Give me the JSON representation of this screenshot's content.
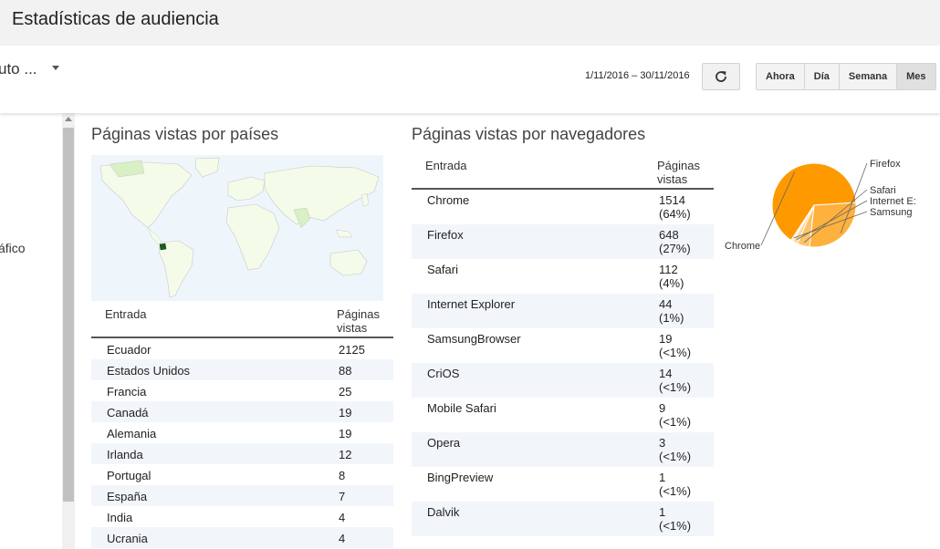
{
  "header": {
    "title": "Estadísticas de audiencia"
  },
  "toolbar": {
    "dropdown_text": "uto ...",
    "date_range": "1/11/2016 – 30/11/2016",
    "refresh_icon": "refresh-icon",
    "periods": [
      {
        "label": "Ahora",
        "active": false
      },
      {
        "label": "Día",
        "active": false
      },
      {
        "label": "Semana",
        "active": false
      },
      {
        "label": "Mes",
        "active": true
      }
    ]
  },
  "sidebar": {
    "label": "áfico"
  },
  "countries": {
    "title": "Páginas vistas por países",
    "columns": [
      "Entrada",
      "Páginas vistas"
    ],
    "rows": [
      {
        "entry": "Ecuador",
        "views": "2125"
      },
      {
        "entry": "Estados Unidos",
        "views": "88"
      },
      {
        "entry": "Francia",
        "views": "25"
      },
      {
        "entry": "Canadá",
        "views": "19"
      },
      {
        "entry": "Alemania",
        "views": "19"
      },
      {
        "entry": "Irlanda",
        "views": "12"
      },
      {
        "entry": "Portugal",
        "views": "8"
      },
      {
        "entry": "España",
        "views": "7"
      },
      {
        "entry": "India",
        "views": "4"
      },
      {
        "entry": "Ucrania",
        "views": "4"
      }
    ]
  },
  "browsers": {
    "title": "Páginas vistas por navegadores",
    "columns": [
      "Entrada",
      "Páginas vistas"
    ],
    "rows": [
      {
        "entry": "Chrome",
        "views": "1514",
        "pct": "(64%)"
      },
      {
        "entry": "Firefox",
        "views": "648",
        "pct": "(27%)"
      },
      {
        "entry": "Safari",
        "views": "112",
        "pct": "(4%)"
      },
      {
        "entry": "Internet Explorer",
        "views": "44",
        "pct": "(1%)"
      },
      {
        "entry": "SamsungBrowser",
        "views": "19",
        "pct": "(<1%)"
      },
      {
        "entry": "CriOS",
        "views": "14",
        "pct": "(<1%)"
      },
      {
        "entry": "Mobile Safari",
        "views": "9",
        "pct": "(<1%)"
      },
      {
        "entry": "Opera",
        "views": "3",
        "pct": "(<1%)"
      },
      {
        "entry": "BingPreview",
        "views": "1",
        "pct": "(<1%)"
      },
      {
        "entry": "Dalvik",
        "views": "1",
        "pct": "(<1%)"
      }
    ]
  },
  "chart_data": {
    "type": "pie",
    "categories": [
      "Chrome",
      "Firefox",
      "Safari",
      "Internet Explorer",
      "Samsung"
    ],
    "values": [
      1514,
      648,
      112,
      44,
      19
    ],
    "labels": [
      "Chrome",
      "Firefox",
      "Safari",
      "Internet E:",
      "Samsung"
    ],
    "colors": [
      "#ff9900",
      "#ffb13d",
      "#ffc266",
      "#ffd699",
      "#ffe6c2"
    ]
  },
  "colors": {
    "accent": "#ff9900",
    "map_land": "#f5fbe9",
    "map_highlight": "#1b5e20",
    "map_water": "#eef6fc"
  }
}
